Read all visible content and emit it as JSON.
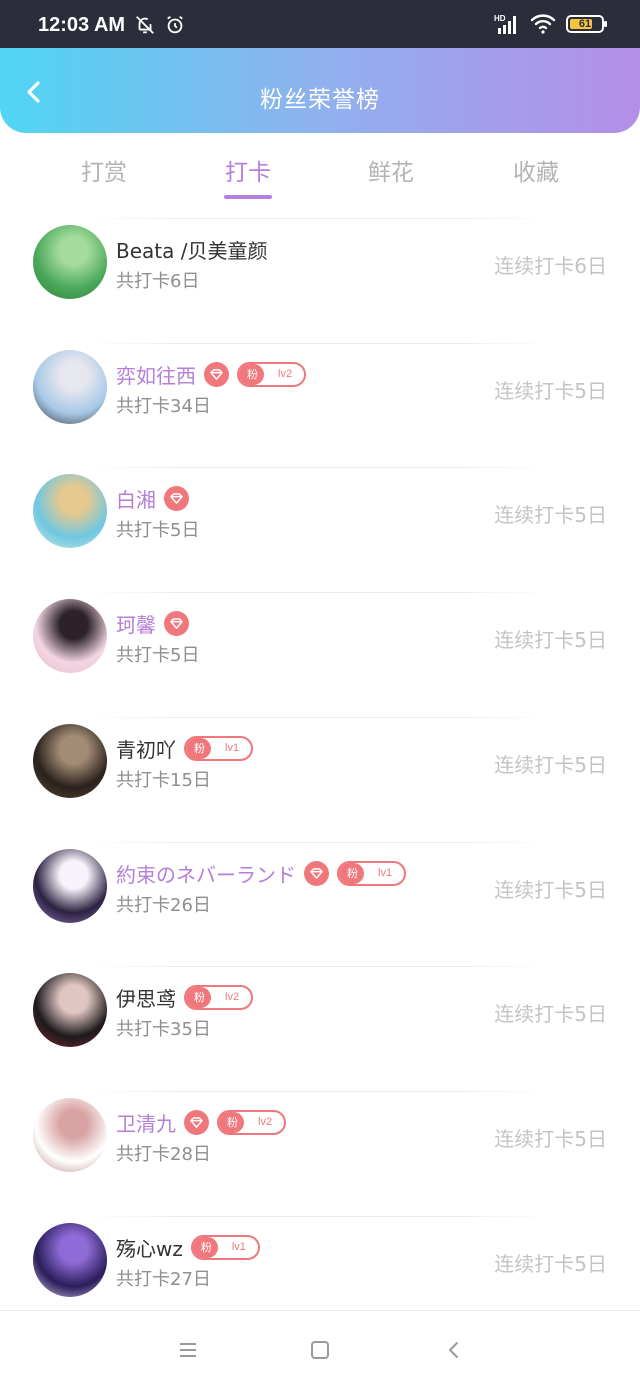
{
  "status_bar": {
    "time": "12:03 AM",
    "battery": "61",
    "icons": [
      "bell-off-icon",
      "alarm-icon",
      "hd-signal-icon",
      "wifi-icon",
      "battery-icon"
    ]
  },
  "header": {
    "title": "粉丝荣誉榜",
    "gradient": [
      "#4fd6f2",
      "#b58ee8"
    ]
  },
  "tabs": [
    {
      "label": "打赏",
      "active": false
    },
    {
      "label": "打卡",
      "active": true
    },
    {
      "label": "鲜花",
      "active": false
    },
    {
      "label": "收藏",
      "active": false
    }
  ],
  "colors": {
    "accent": "#b77fe0",
    "vip_name": "#b47fd8",
    "badge": "#f0787c",
    "muted": "#c4c4c4"
  },
  "fan_label": "粉",
  "fans": [
    {
      "name": "Beata /贝美童颜",
      "vip": false,
      "diamond": false,
      "level": "",
      "total": "共打卡6日",
      "streak": "连续打卡6日",
      "avatar_colors": [
        "#4ba85a",
        "#a5dc9c",
        "#2f7d3c"
      ]
    },
    {
      "name": "弈如往西",
      "vip": true,
      "diamond": true,
      "level": "lv2",
      "total": "共打卡34日",
      "streak": "连续打卡5日",
      "avatar_colors": [
        "#a7c8e6",
        "#e7e7ef",
        "#2a2a33"
      ]
    },
    {
      "name": "白湘",
      "vip": true,
      "diamond": true,
      "level": "",
      "total": "共打卡5日",
      "streak": "连续打卡5日",
      "avatar_colors": [
        "#6fc7e3",
        "#e5c98e",
        "#d8ead6"
      ]
    },
    {
      "name": "珂馨",
      "vip": true,
      "diamond": true,
      "level": "",
      "total": "共打卡5日",
      "streak": "连续打卡5日",
      "avatar_colors": [
        "#f3d6e3",
        "#2c2228",
        "#e9b8c9"
      ]
    },
    {
      "name": "青初吖",
      "vip": false,
      "diamond": false,
      "level": "lv1",
      "total": "共打卡15日",
      "streak": "连续打卡5日",
      "avatar_colors": [
        "#2a211c",
        "#a38c76",
        "#5d4a3e"
      ]
    },
    {
      "name": "約束のネバーランド",
      "vip": true,
      "diamond": true,
      "level": "lv1",
      "total": "共打卡26日",
      "streak": "连续打卡5日",
      "avatar_colors": [
        "#2b2240",
        "#f7f2fb",
        "#9a7cc9"
      ]
    },
    {
      "name": "伊思鸢",
      "vip": false,
      "diamond": false,
      "level": "lv2",
      "total": "共打卡35日",
      "streak": "连续打卡5日",
      "avatar_colors": [
        "#1d1a1c",
        "#dfc6c2",
        "#8a2a35"
      ]
    },
    {
      "name": "卫清九",
      "vip": true,
      "diamond": true,
      "level": "lv2",
      "total": "共打卡28日",
      "streak": "连续打卡5日",
      "avatar_colors": [
        "#ffffff",
        "#d9a3a3",
        "#b98080"
      ]
    },
    {
      "name": "殇心wz",
      "vip": false,
      "diamond": false,
      "level": "lv1",
      "total": "共打卡27日",
      "streak": "连续打卡5日",
      "avatar_colors": [
        "#2a1d5a",
        "#8e6bd6",
        "#e0d2f5"
      ]
    }
  ],
  "nav": [
    "menu-icon",
    "home-square-icon",
    "back-chevron-icon"
  ]
}
